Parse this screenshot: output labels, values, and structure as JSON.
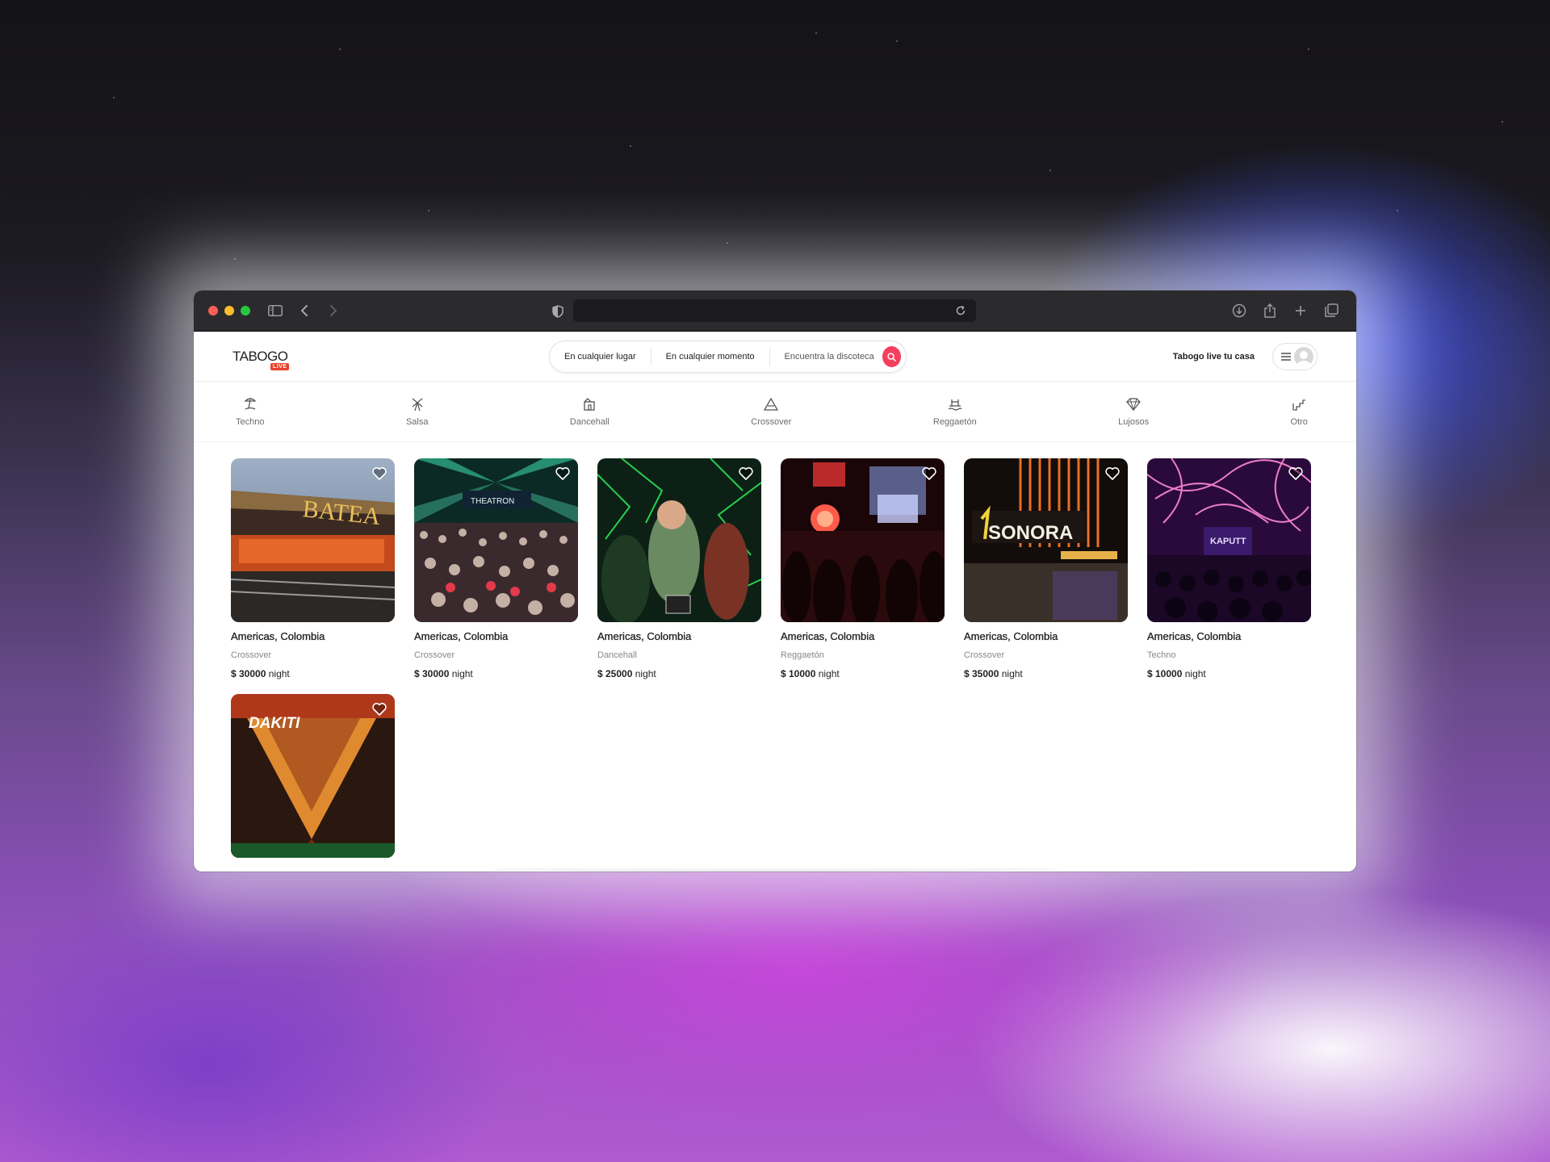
{
  "browser": {
    "url": "",
    "icons": [
      "sidebar-icon",
      "back-icon",
      "forward-icon",
      "shield-icon",
      "reload-icon",
      "download-icon",
      "share-icon",
      "new-tab-icon",
      "tabs-overview-icon"
    ]
  },
  "header": {
    "logo_text": "TABOGO",
    "logo_badge": "LIVE",
    "search": {
      "where": "En cualquier lugar",
      "when": "En cualquier momento",
      "what": "Encuentra la discoteca"
    },
    "host_link": "Tabogo live tu casa",
    "accent_color": "#f43f5e"
  },
  "categories": [
    {
      "label": "Techno",
      "icon": "beach-icon"
    },
    {
      "label": "Salsa",
      "icon": "windmill-icon"
    },
    {
      "label": "Dancehall",
      "icon": "building-icon"
    },
    {
      "label": "Crossover",
      "icon": "mountain-icon"
    },
    {
      "label": "Reggaetón",
      "icon": "island-icon"
    },
    {
      "label": "Lujosos",
      "icon": "diamond-icon"
    },
    {
      "label": "Otro",
      "icon": "stairs-icon"
    }
  ],
  "listings": [
    {
      "location": "Americas, Colombia",
      "genre": "Crossover",
      "price": "$ 30000",
      "unit": "night",
      "sign": "BATEA"
    },
    {
      "location": "Americas, Colombia",
      "genre": "Crossover",
      "price": "$ 30000",
      "unit": "night",
      "sign": "THEATRON"
    },
    {
      "location": "Americas, Colombia",
      "genre": "Dancehall",
      "price": "$ 25000",
      "unit": "night",
      "sign": ""
    },
    {
      "location": "Americas, Colombia",
      "genre": "Reggaetón",
      "price": "$ 10000",
      "unit": "night",
      "sign": ""
    },
    {
      "location": "Americas, Colombia",
      "genre": "Crossover",
      "price": "$ 35000",
      "unit": "night",
      "sign": "SONORA"
    },
    {
      "location": "Americas, Colombia",
      "genre": "Techno",
      "price": "$ 10000",
      "unit": "night",
      "sign": "KAPUTT"
    },
    {
      "location": "",
      "genre": "",
      "price": "",
      "unit": "",
      "sign": "DAKITI"
    }
  ]
}
